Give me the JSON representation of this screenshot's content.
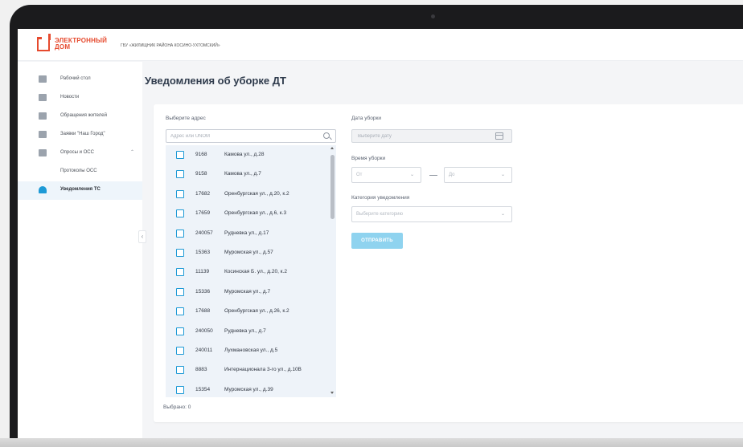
{
  "header": {
    "logo_line1": "ЭЛЕКТРОННЫЙ",
    "logo_line2": "ДОМ",
    "org_name": "ГБУ «ЖИЛИЩНИК РАЙОНА КОСИНО-УХТОМСКИЙ»"
  },
  "sidebar": {
    "items": [
      {
        "label": "Рабочий стол",
        "icon": "dashboard-icon"
      },
      {
        "label": "Новости",
        "icon": "news-icon"
      },
      {
        "label": "Обращения жителей",
        "icon": "residents-icon"
      },
      {
        "label": "Заявки \"Наш Город\"",
        "icon": "mail-icon"
      },
      {
        "label": "Опросы и ОСС",
        "icon": "chart-icon"
      },
      {
        "label": "Протоколы ОСС",
        "icon": ""
      },
      {
        "label": "Уведомления ТС",
        "icon": "bell-icon"
      }
    ]
  },
  "page": {
    "title": "Уведомления об уборке ДТ"
  },
  "form": {
    "address_label": "Выберите адрес",
    "search_placeholder": "Адрес или UNOM",
    "addresses": [
      {
        "unom": "9168",
        "address": "Камова ул., д.28"
      },
      {
        "unom": "9158",
        "address": "Камова ул., д.7"
      },
      {
        "unom": "17682",
        "address": "Оренбургская ул., д.20, к.2"
      },
      {
        "unom": "17659",
        "address": "Оренбургская ул., д.6, к.3"
      },
      {
        "unom": "240057",
        "address": "Рудневка ул., д.17"
      },
      {
        "unom": "15363",
        "address": "Муромская ул., д.57"
      },
      {
        "unom": "11139",
        "address": "Косинская Б. ул., д.20, к.2"
      },
      {
        "unom": "15336",
        "address": "Муромская ул., д.7"
      },
      {
        "unom": "17688",
        "address": "Оренбургская ул., д.26, к.2"
      },
      {
        "unom": "240050",
        "address": "Рудневка ул., д.7"
      },
      {
        "unom": "240011",
        "address": "Лухмановская ул., д.5"
      },
      {
        "unom": "8883",
        "address": "Интернационала 3-го ул., д.10В"
      },
      {
        "unom": "15354",
        "address": "Муромская ул., д.39"
      }
    ],
    "selected_text": "Выбрано: 0",
    "date_label": "Дата уборки",
    "date_placeholder": "Выберите дату",
    "time_label": "Время уборки",
    "time_from_placeholder": "От",
    "time_to_placeholder": "До",
    "category_label": "Категория уведомления",
    "category_placeholder": "Выберите категорию",
    "submit_label": "ОТПРАВИТЬ"
  },
  "colors": {
    "brand": "#e64a2e",
    "accent": "#1e9ad6",
    "button": "#8fd3ef"
  }
}
